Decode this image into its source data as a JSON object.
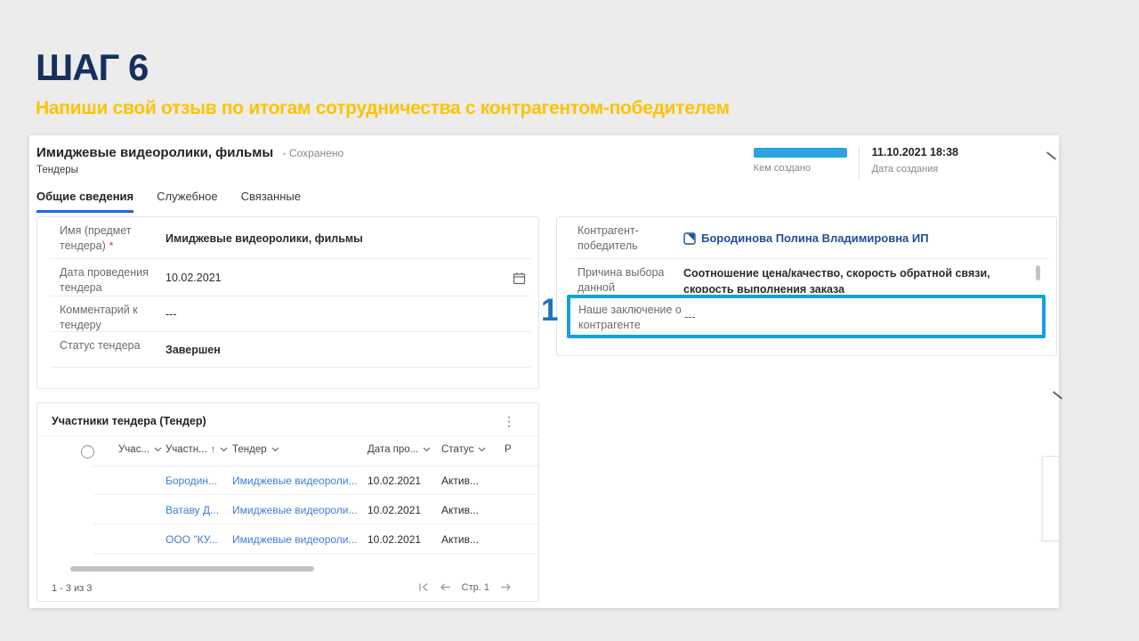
{
  "slide": {
    "title": "ШАГ 6",
    "subtitle": "Напиши свой отзыв по итогам сотрудничества с контрагентом-победителем"
  },
  "header": {
    "record_title": "Имиджевые видеоролики, фильмы",
    "save_status": "- Сохранено",
    "entity_name": "Тендеры",
    "created_by_label": "Кем создано",
    "created_on": "11.10.2021 18:38",
    "created_on_label": "Дата создания"
  },
  "tabs": [
    "Общие сведения",
    "Служебное",
    "Связанные"
  ],
  "general": {
    "fields": [
      {
        "label": "Имя (предмет тендера)",
        "required_mark": "*",
        "value": "Имиджевые видеоролики, фильмы"
      },
      {
        "label": "Дата проведения тендера",
        "value": "10.02.2021",
        "icon": "calendar-icon"
      },
      {
        "label": "Комментарий к тендеру",
        "value": "---"
      },
      {
        "label": "Статус тендера",
        "value": "Завершен"
      }
    ]
  },
  "winner": {
    "fields": [
      {
        "label": "Контрагент-победитель",
        "value": "Бородинова Полина Владимировна ИП",
        "icon": "contact-icon"
      },
      {
        "label": "Причина выбора данной организации",
        "value": "Соотношение цена/качество, скорость обратной связи, скорость выполнения заказа"
      },
      {
        "label": "Наше заключение о контрагенте",
        "value": "---",
        "highlighted": true
      }
    ]
  },
  "callout": {
    "number": "1"
  },
  "table": {
    "title": "Участники тендера (Тендер)",
    "columns": [
      {
        "label": "Учас..."
      },
      {
        "label": "Участн...",
        "sort": "↑"
      },
      {
        "label": "Тендер"
      },
      {
        "label": "Дата про..."
      },
      {
        "label": "Статус"
      },
      {
        "label": "Р"
      }
    ],
    "rows": [
      {
        "participant": "Бородин...",
        "tender": "Имиджевые видеороли...",
        "date": "10.02.2021",
        "status": "Актив..."
      },
      {
        "participant": "Ватаву Д...",
        "tender": "Имиджевые видеороли...",
        "date": "10.02.2021",
        "status": "Актив..."
      },
      {
        "participant": "ООО \"КУ...",
        "tender": "Имиджевые видеороли...",
        "date": "10.02.2021",
        "status": "Актив..."
      }
    ],
    "record_count": "1 - 3 из 3",
    "page_label": "Стр. 1"
  },
  "icons": {
    "more_vertical": "⋮"
  },
  "colors": {
    "title_navy": "#16305e",
    "accent_yellow": "#fcc306",
    "callout_blue": "#17a0e0",
    "redaction_blue": "#2ba3e2",
    "tab_active_blue": "#2065dd",
    "grid_link_blue": "#3e7dd6",
    "lookup_link_navy": "#1f4e99"
  }
}
